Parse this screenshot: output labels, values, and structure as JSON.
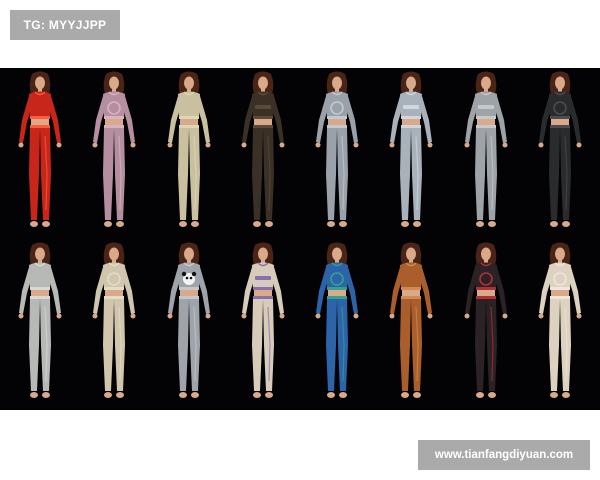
{
  "tag_label": "TG: MYYJJPP",
  "watermark_label": "www.tianfangdiyuan.com",
  "outfits": [
    {
      "color": "#c8261a",
      "accent": "#ff5a3a",
      "emblem": "none"
    },
    {
      "color": "#b58fa0",
      "accent": "#d7b3c2",
      "emblem": "graphic"
    },
    {
      "color": "#c9c0a0",
      "accent": "#ddd5b8",
      "emblem": "none"
    },
    {
      "color": "#3a3026",
      "accent": "#5a4a38",
      "emblem": "text"
    },
    {
      "color": "#9aa1a9",
      "accent": "#c2c8cf",
      "emblem": "graphic"
    },
    {
      "color": "#a9b2bb",
      "accent": "#d0d6dc",
      "emblem": "text"
    },
    {
      "color": "#9ea3a8",
      "accent": "#c5c9cd",
      "emblem": "text"
    },
    {
      "color": "#2a2b2d",
      "accent": "#4a4c50",
      "emblem": "graphic"
    },
    {
      "color": "#b7b9b6",
      "accent": "#d7d9d5",
      "emblem": "none"
    },
    {
      "color": "#cfc6ad",
      "accent": "#e4dcc7",
      "emblem": "graphic"
    },
    {
      "color": "#9fa4ab",
      "accent": "#c4c8cd",
      "emblem": "panda"
    },
    {
      "color": "#d6ccb9",
      "accent": "#8a6fb0",
      "emblem": "text"
    },
    {
      "color": "#2d63a8",
      "accent": "#2fa58d",
      "emblem": "graphic"
    },
    {
      "color": "#a95e2c",
      "accent": "#d48a4e",
      "emblem": "none"
    },
    {
      "color": "#2a2224",
      "accent": "#b0303a",
      "emblem": "graphic"
    },
    {
      "color": "#ddd2c0",
      "accent": "#eee6d8",
      "emblem": "graphic"
    }
  ]
}
